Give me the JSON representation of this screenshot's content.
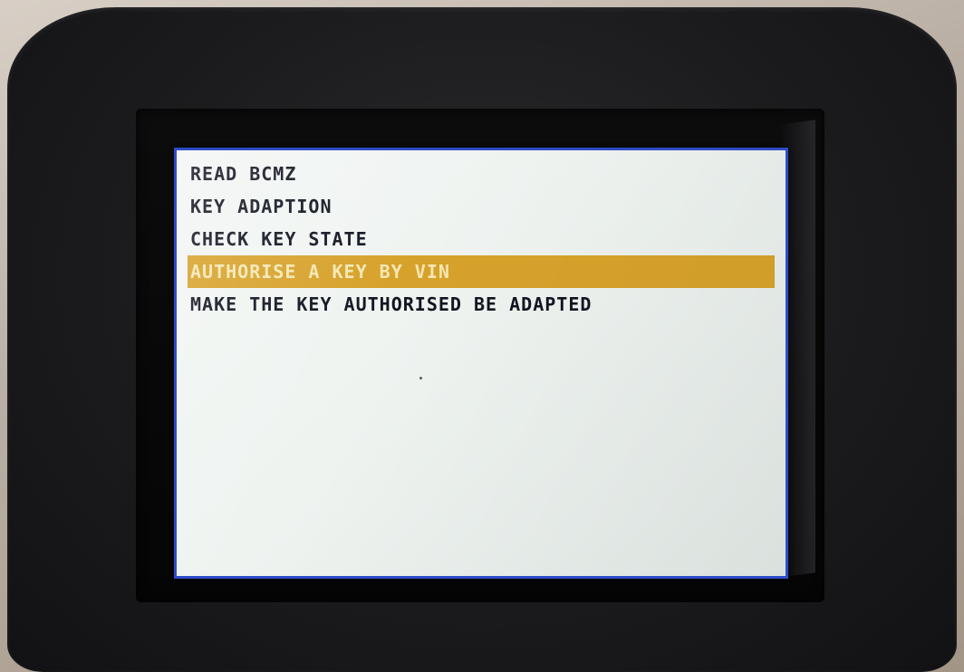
{
  "device": {
    "screen_border_color": "#2e4cc8",
    "highlight_color": "#d7a22b"
  },
  "menu": {
    "selected_index": 3,
    "items": [
      {
        "label": "READ BCMZ"
      },
      {
        "label": "KEY ADAPTION"
      },
      {
        "label": "CHECK KEY STATE"
      },
      {
        "label": "AUTHORISE A KEY BY VIN"
      },
      {
        "label": "MAKE THE KEY AUTHORISED BE ADAPTED"
      }
    ]
  }
}
